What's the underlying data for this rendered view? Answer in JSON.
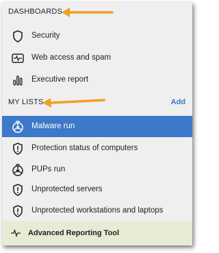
{
  "dashboards": {
    "title": "DASHBOARDS",
    "items": [
      {
        "label": "Security",
        "icon": "shield-icon"
      },
      {
        "label": "Web access and spam",
        "icon": "activity-monitor-icon"
      },
      {
        "label": "Executive report",
        "icon": "bar-chart-icon"
      }
    ]
  },
  "my_lists": {
    "title": "MY LISTS",
    "add_label": "Add",
    "items": [
      {
        "label": "Malware run",
        "icon": "biohazard-icon",
        "selected": true
      },
      {
        "label": "Protection status of computers",
        "icon": "shield-alert-icon"
      },
      {
        "label": "PUPs run",
        "icon": "biohazard-icon"
      },
      {
        "label": "Unprotected servers",
        "icon": "shield-alert-icon"
      },
      {
        "label": "Unprotected workstations and laptops",
        "icon": "shield-alert-icon"
      }
    ]
  },
  "footer": {
    "label": "Advanced Reporting Tool",
    "icon": "pulse-icon"
  },
  "colors": {
    "selected_bg": "#3d78c9",
    "annotation_arrow": "#f0a020",
    "add_link": "#3a78c4",
    "footer_bg": "#e6ecd4"
  }
}
